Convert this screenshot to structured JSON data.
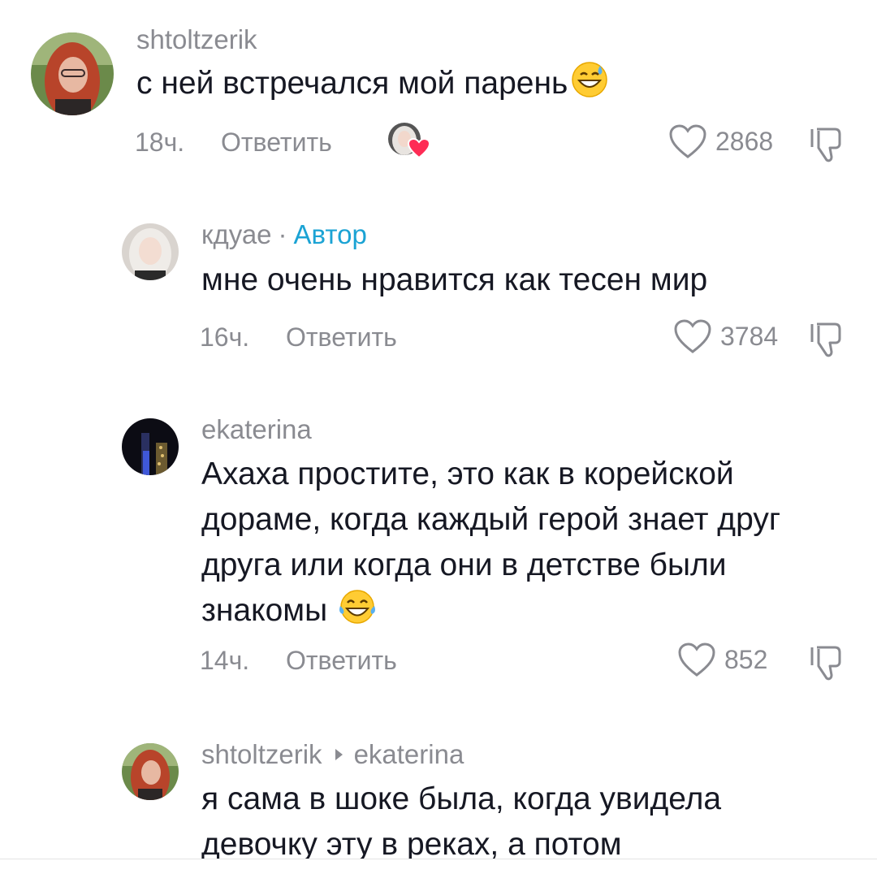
{
  "comments": [
    {
      "username": "shtoltzerik",
      "text": "с ней встречался мой парень",
      "emoji": "grinning-sweat-emoji",
      "time": "18ч.",
      "reply_label": "Ответить",
      "likes": "2868",
      "liked_by_creator": true
    },
    {
      "username": "кдуае",
      "separator": "·",
      "author_badge": "Автор",
      "text": "мне очень нравится как тесен мир",
      "time": "16ч.",
      "reply_label": "Ответить",
      "likes": "3784"
    },
    {
      "username": "ekaterina",
      "text_lines": [
        "Ахаха простите, это как в корейской",
        "дораме, когда каждый герой знает друг",
        "друга или когда они в детстве были",
        "знакомы"
      ],
      "emoji": "tears-of-joy-emoji",
      "time": "14ч.",
      "reply_label": "Ответить",
      "likes": "852"
    },
    {
      "username": "shtoltzerik",
      "reply_to": "ekaterina",
      "text_lines": [
        "я сама в шоке была, когда увидела",
        "девочку эту в реках, а потом"
      ]
    }
  ],
  "icons": {
    "like": "heart-outline-icon",
    "dislike": "thumbs-down-icon",
    "creator_like": "red-heart-icon"
  },
  "colors": {
    "author_badge": "#1ba3d4",
    "secondary_text": "#8a8b91",
    "primary_text": "#161823",
    "creator_heart": "#fe2c55"
  }
}
